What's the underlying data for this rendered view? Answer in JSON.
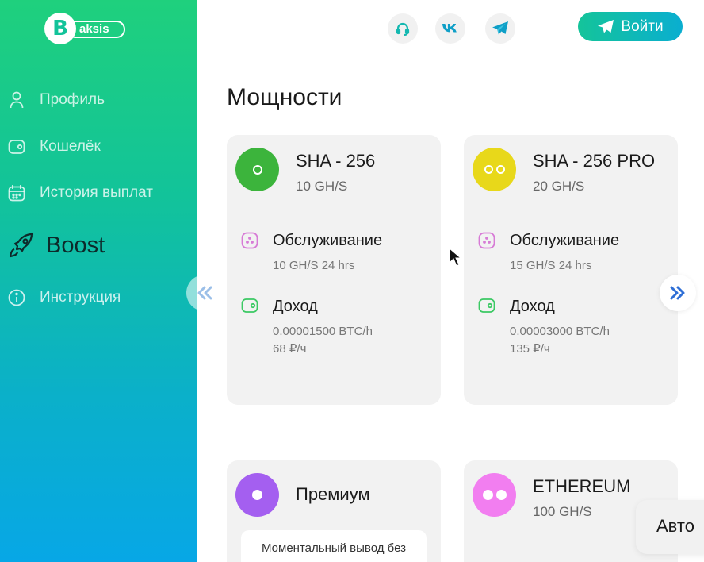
{
  "brand": {
    "logo_letter": "B",
    "logo_text": "aksis"
  },
  "sidebar": {
    "items": [
      {
        "label": "Профиль",
        "icon": "user-icon"
      },
      {
        "label": "Кошелёк",
        "icon": "wallet-icon"
      },
      {
        "label": "История выплат",
        "icon": "calendar-icon"
      },
      {
        "label": "Boost",
        "icon": "rocket-icon",
        "active": true
      },
      {
        "label": "Инструкция",
        "icon": "info-icon"
      }
    ]
  },
  "header": {
    "icons": [
      "support-headset-icon",
      "vk-icon",
      "telegram-icon"
    ],
    "login_label": "Войти"
  },
  "main": {
    "title": "Мощности",
    "cards": [
      {
        "name": "SHA - 256",
        "speed": "10 GH/S",
        "color": "#3cb43c",
        "service_label": "Обслуживание",
        "service_value": "10 GH/S 24 hrs",
        "income_label": "Доход",
        "income_btc": "0.00001500 BTC/h",
        "income_rub": "68 ₽/ч"
      },
      {
        "name": "SHA - 256 PRO",
        "speed": "20 GH/S",
        "color": "#e8d81a",
        "service_label": "Обслуживание",
        "service_value": "15 GH/S 24 hrs",
        "income_label": "Доход",
        "income_btc": "0.00003000 BTC/h",
        "income_rub": "135 ₽/ч"
      },
      {
        "name": "Премиум",
        "color": "#a45ff0",
        "note": "Моментальный вывод без комиссии"
      },
      {
        "name": "ETHEREUM",
        "speed": "100 GH/S",
        "color": "#f27ef0"
      }
    ]
  },
  "auto_badge": "Авто",
  "colors": {
    "accent": "#14c49a",
    "service_icon": "#d77bd6",
    "income_icon": "#3cc964"
  }
}
